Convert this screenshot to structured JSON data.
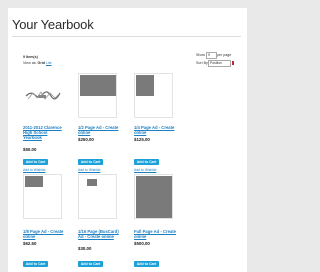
{
  "page": {
    "title": "Your Yearbook"
  },
  "toolbar": {
    "items_count": "9 Item(s)",
    "view_as_label": "View as:",
    "view_grid": "Grid",
    "view_list": "List",
    "show_label": "Show",
    "show_value": "9",
    "per_page": "per page",
    "sort_label": "Sort By",
    "sort_value": "Position"
  },
  "products": [
    {
      "name": "2011-2012 Clarence High School Yearbook",
      "price": "$50.00",
      "button": "Add to Cart",
      "wishlist": "Add to Wishlist"
    },
    {
      "name": "1/2 Page Ad - Create online",
      "price": "$250.00",
      "button": "Add to Cart",
      "wishlist": "Add to Wishlist"
    },
    {
      "name": "1/4 Page Ad - Create online",
      "price": "$125.00",
      "button": "Add to Cart",
      "wishlist": "Add to Wishlist"
    },
    {
      "name": "1/8 Page Ad - Create online",
      "price": "$62.50",
      "button": "Add to Cart",
      "wishlist": "Add to Wishlist"
    },
    {
      "name": "1/16 Page (BusCard) Ad - Create online",
      "price": "$30.00",
      "button": "Add to Cart",
      "wishlist": "Add to Wishlist"
    },
    {
      "name": "Full Page Ad - Create online",
      "price": "$500.00",
      "button": "Add to Cart",
      "wishlist": "Add to Wishlist"
    }
  ]
}
